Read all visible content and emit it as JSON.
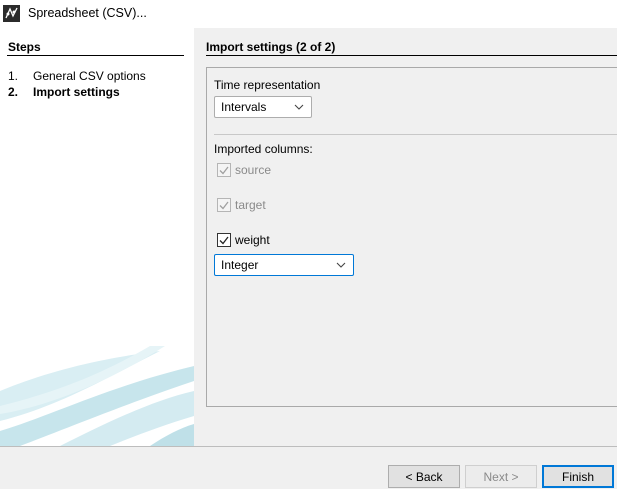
{
  "window": {
    "title": "Spreadsheet (CSV)..."
  },
  "steps": {
    "title": "Steps",
    "items": [
      {
        "num": "1.",
        "label": "General CSV options",
        "current": false
      },
      {
        "num": "2.",
        "label": "Import settings",
        "current": true
      }
    ]
  },
  "main": {
    "title": "Import settings (2 of 2)",
    "time_representation": {
      "label": "Time representation",
      "selected": "Intervals"
    },
    "imported_columns": {
      "label": "Imported columns:",
      "columns": [
        {
          "name": "source",
          "checked": true,
          "enabled": false
        },
        {
          "name": "target",
          "checked": true,
          "enabled": false
        },
        {
          "name": "weight",
          "checked": true,
          "enabled": true
        }
      ],
      "weight_type": "Integer"
    }
  },
  "buttons": {
    "back": "< Back",
    "next": "Next >",
    "finish": "Finish"
  },
  "colors": {
    "accent": "#0078d7",
    "swoosh": "#cfe8ee"
  }
}
